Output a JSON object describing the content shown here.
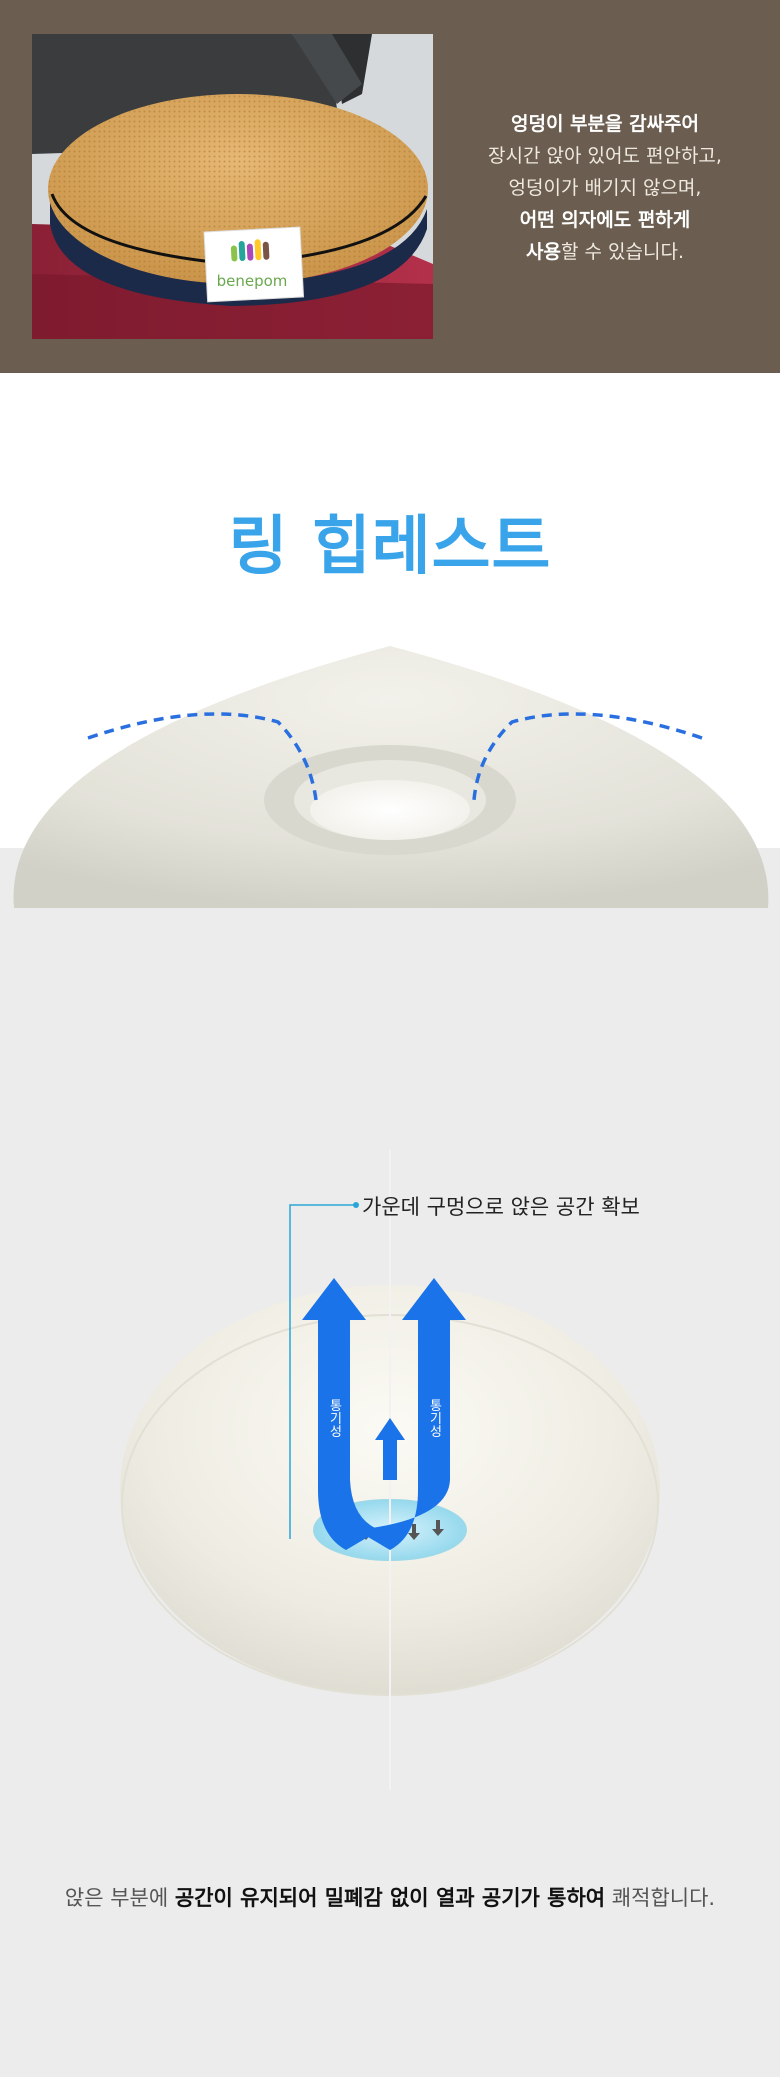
{
  "top": {
    "logo_text": "benepom",
    "lines": [
      {
        "parts": [
          {
            "text": "엉덩이 부분을 감싸주어",
            "bold": true
          }
        ]
      },
      {
        "parts": [
          {
            "text": "장시간 앉아 있어도 편안하고,",
            "bold": false
          }
        ]
      },
      {
        "parts": [
          {
            "text": "엉덩이가 배기지 않으며,",
            "bold": false
          }
        ]
      },
      {
        "parts": [
          {
            "text": "어떤 의자에도 편하게",
            "bold": true
          }
        ]
      },
      {
        "parts": [
          {
            "text": "사용",
            "bold": true
          },
          {
            "text": "할 수 있습니다.",
            "bold": false
          }
        ]
      }
    ]
  },
  "title": "링 힙레스트",
  "diagram": {
    "callout": "가운데 구멍으로 앉은 공간 확보",
    "left_arrow_label": "통기성",
    "right_arrow_label": "통기성"
  },
  "bottom": {
    "parts": [
      {
        "text": "앉은 부분에 ",
        "bold": false
      },
      {
        "text": "공간이 유지되어 밀폐감 없이 열과 공기가 통하여",
        "bold": true
      },
      {
        "text": " 쾌적합니다.",
        "bold": false
      }
    ]
  },
  "colors": {
    "brown_bg": "#6b5e50",
    "title_blue": "#3aa4ea",
    "arrow_blue": "#1a73e8",
    "dash_blue": "#2a6fe0",
    "gray_bg": "#ececec"
  }
}
